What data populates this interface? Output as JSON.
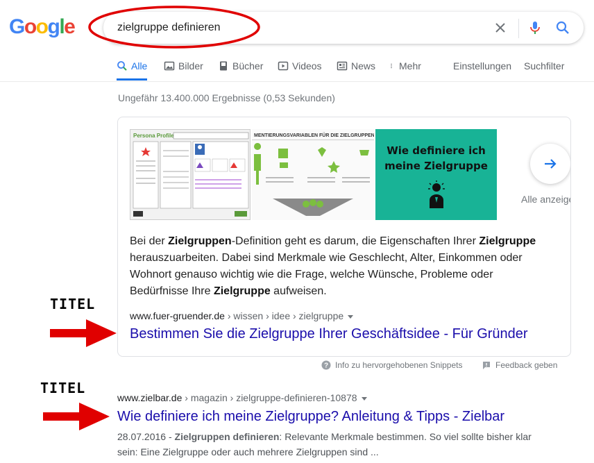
{
  "logo": {
    "g1": "G",
    "o1": "o",
    "o2": "o",
    "g2": "g",
    "l": "l",
    "e": "e"
  },
  "search": {
    "query": "zielgruppe definieren"
  },
  "tabs": [
    {
      "label": "Alle",
      "icon": "search-icon",
      "active": true
    },
    {
      "label": "Bilder",
      "icon": "image-icon"
    },
    {
      "label": "Bücher",
      "icon": "book-icon"
    },
    {
      "label": "Videos",
      "icon": "play-icon"
    },
    {
      "label": "News",
      "icon": "news-icon"
    },
    {
      "label": "Mehr",
      "icon": "more-vertical-icon"
    }
  ],
  "tools": {
    "settings": "Einstellungen",
    "filter": "Suchfilter"
  },
  "stats": "Ungefähr 13.400.000 Ergebnisse (0,53 Sekunden)",
  "featured": {
    "images": [
      {
        "title": "Persona Profile:"
      },
      {
        "title": "MENTIERUNGSVARIABLEN FÜR DIE ZIELGRUPPENANAL"
      },
      {
        "line1": "Wie definiere ich",
        "line2": "meine Zielgruppe"
      }
    ],
    "show_all": "Alle anzeigen",
    "snippet": {
      "p1": "Bei der ",
      "b1": "Zielgruppen",
      "p2": "-Definition geht es darum, die Eigenschaften Ihrer ",
      "b2": "Zielgruppe",
      "p3": " herauszuarbeiten. Dabei sind Merkmale wie Geschlecht, Alter, Einkommen oder Wohnort genauso wichtig wie die Frage, welche Wünsche, Probleme oder Bedürfnisse Ihre ",
      "b3": "Zielgruppe",
      "p4": " aufweisen."
    },
    "cite": {
      "domain": "www.fuer-gruender.de",
      "path": " › wissen › idee › zielgruppe"
    },
    "title": "Bestimmen Sie die Zielgruppe Ihrer Geschäftsidee - Für Gründer",
    "info": "Info zu hervorgehobenen Snippets",
    "feedback": "Feedback geben"
  },
  "result2": {
    "cite": {
      "domain": "www.zielbar.de",
      "path": " › magazin › zielgruppe-definieren-10878"
    },
    "title": "Wie definiere ich meine Zielgruppe? Anleitung & Tipps - Zielbar",
    "date": "28.07.2016 - ",
    "bold": "Zielgruppen definieren",
    "rest": ": Relevante Merkmale bestimmen. So viel sollte bisher klar sein: Eine Zielgruppe oder auch mehrere Zielgruppen sind ..."
  },
  "annotations": {
    "label1": "TITEL",
    "label2": "TITEL"
  },
  "colors": {
    "link": "#1a0dab",
    "accent": "#1a73e8",
    "annotation": "#e00000"
  }
}
